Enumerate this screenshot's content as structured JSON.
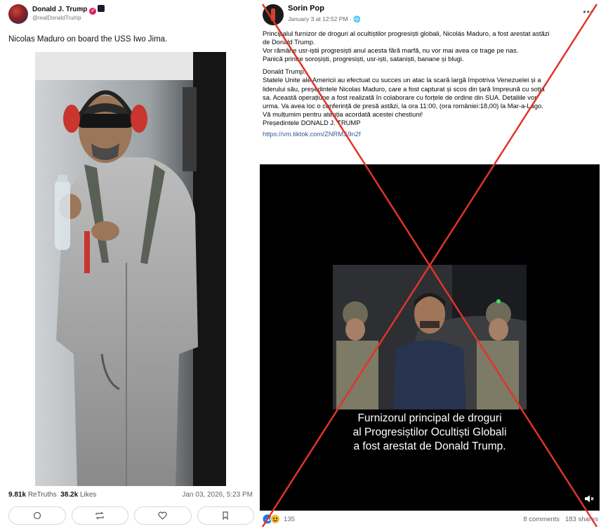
{
  "left_post": {
    "author_name": "Donald J. Trump",
    "author_handle": "@realDonaldTrump",
    "text": "Nicolas Maduro on board the USS Iwo Jima.",
    "retruths_count": "9.81k",
    "retruths_label": "ReTruths",
    "likes_count": "38.2k",
    "likes_label": "Likes",
    "timestamp": "Jan 03, 2026, 5:23 PM",
    "icons": [
      "reply-icon",
      "retruth-icon",
      "like-icon",
      "bookmark-icon"
    ]
  },
  "right_post": {
    "author_name": "Sorin Pop",
    "timestamp": "January 3 at 12:52 PM · ",
    "paragraph1": [
      "Principalul furnizor de droguri al ocultiștilor progresiști globali, Nicolás Maduro, a fost arestat astăzi",
      "de Donald Trump.",
      "Vor rămâne usr-iștii progresiști anul acesta fără marfă, nu vor mai avea ce trage pe nas.",
      "Panică printre soroșiști, progresiști, usr-iști, sataniști, banane și blugi."
    ],
    "paragraph2": [
      "Donald Trump:",
      "Statele Unite ale Americii au efectuat cu succes un atac la scară largă împotriva Venezuelei și a",
      "liderului său, președintele Nicolas Maduro, care a fost capturat și scos din țară împreună cu soția",
      "sa. Această operațiune a fost realizată în colaborare cu forțele de ordine din SUA. Detaliile vor",
      "urma. Va avea loc o conferință de presă astăzi, la ora 11:00, (ora româniei:18,00) la Mar-a-Lago.",
      "Vă mulțumim pentru atenția acordată acestei chestiuni!",
      "Președintele DONALD J. TRUMP"
    ],
    "link": "https://vm.tiktok.com/ZNRMS9n2f",
    "video_caption": [
      "Furnizorul principal de droguri",
      "al Progresiștilor Ocultiști Globali",
      "a fost arestat de Donald Trump."
    ],
    "reactions_count": "135",
    "comments": "8 comments",
    "shares": "183 shares"
  },
  "colors": {
    "cross_red": "#e0342b",
    "link_blue": "#385898",
    "verified_red": "#e0245e"
  }
}
